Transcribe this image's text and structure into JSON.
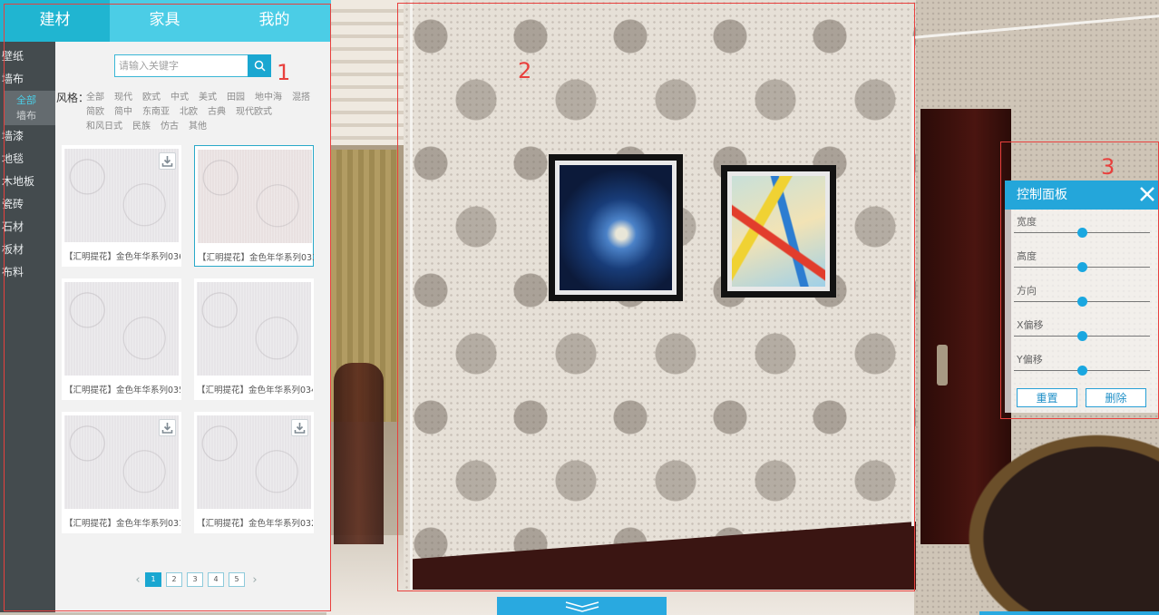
{
  "top_tabs": [
    {
      "label": "建材"
    },
    {
      "label": "家具"
    },
    {
      "label": "我的"
    }
  ],
  "categories": {
    "items_before": [
      "壁纸",
      "墙布"
    ],
    "sub_items": [
      "全部",
      "墙布"
    ],
    "items_after": [
      "墙漆",
      "地毯",
      "木地板",
      "瓷砖",
      "石材",
      "板材",
      "布料"
    ]
  },
  "search": {
    "placeholder": "请输入关键字",
    "value": ""
  },
  "style_filter": {
    "label": "风格：",
    "options": [
      "全部",
      "现代",
      "欧式",
      "中式",
      "美式",
      "田园",
      "地中海",
      "混搭",
      "简欧",
      "简中",
      "东南亚",
      "北欧",
      "古典",
      "现代欧式",
      "和风日式",
      "民族",
      "仿古",
      "其他"
    ]
  },
  "products": [
    {
      "name": "【汇明提花】金色年华系列036",
      "download": true,
      "selected": false
    },
    {
      "name": "【汇明提花】金色年华系列033",
      "download": false,
      "selected": true
    },
    {
      "name": "【汇明提花】金色年华系列035",
      "download": false,
      "selected": false
    },
    {
      "name": "【汇明提花】金色年华系列034",
      "download": false,
      "selected": false
    },
    {
      "name": "【汇明提花】金色年华系列031",
      "download": true,
      "selected": false
    },
    {
      "name": "【汇明提花】金色年华系列032",
      "download": true,
      "selected": false
    }
  ],
  "pagination": {
    "pages": [
      "1",
      "2",
      "3",
      "4",
      "5"
    ],
    "current": "1",
    "prev_icon": "chevron-left",
    "next_icon": "chevron-right"
  },
  "control_panel": {
    "title": "控制面板",
    "sliders": [
      {
        "label": "宽度",
        "value": 0.5
      },
      {
        "label": "高度",
        "value": 0.5
      },
      {
        "label": "方向",
        "value": 0.5
      },
      {
        "label": "X偏移",
        "value": 0.5
      },
      {
        "label": "Y偏移",
        "value": 0.5
      }
    ],
    "reset_label": "重置",
    "delete_label": "删除"
  },
  "annotations": [
    "1",
    "2",
    "3"
  ],
  "colors": {
    "accent": "#20b5d1",
    "tab_bar": "#4bcde6",
    "sidebar": "#444b4e",
    "annotation": "#e8403d",
    "panel_header": "#24a6da"
  }
}
